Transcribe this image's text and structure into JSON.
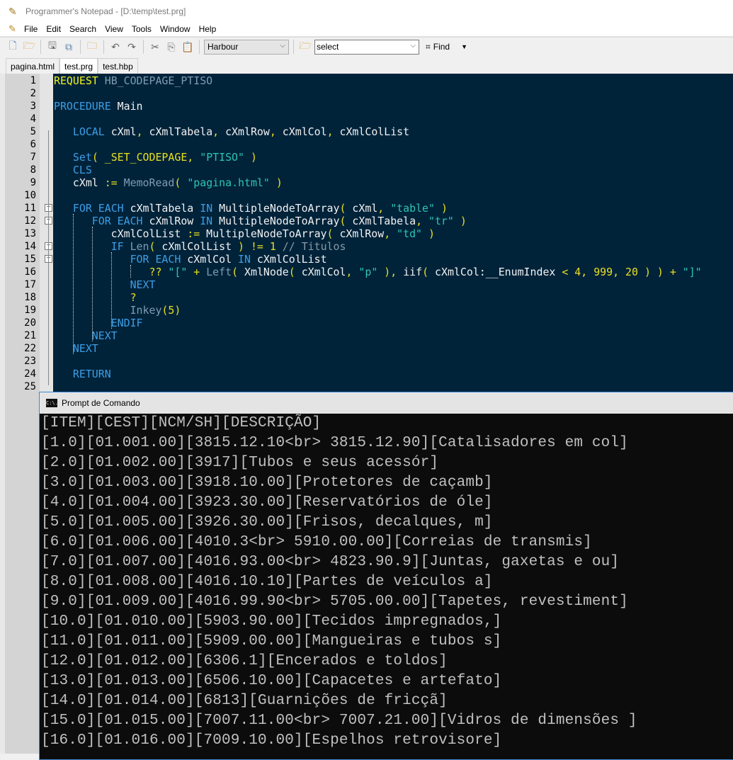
{
  "window": {
    "title": "Programmer's Notepad - [D:\\temp\\test.prg]"
  },
  "menu": [
    "File",
    "Edit",
    "Search",
    "View",
    "Tools",
    "Window",
    "Help"
  ],
  "toolbar": {
    "scheme": "Harbour",
    "find_input": "select",
    "find_label": "Find"
  },
  "tabs": [
    {
      "label": "pagina.html",
      "active": false
    },
    {
      "label": "test.prg",
      "active": true
    },
    {
      "label": "test.hbp",
      "active": false
    }
  ],
  "editor": {
    "lines": [
      [
        [
          "pp",
          "REQUEST"
        ],
        [
          "id",
          " "
        ],
        [
          "cst",
          "HB_CODEPAGE_PTISO"
        ]
      ],
      [],
      [
        [
          "kw",
          "PROCEDURE"
        ],
        [
          "id",
          " Main"
        ]
      ],
      [],
      [
        [
          "id",
          "   "
        ],
        [
          "kw",
          "LOCAL"
        ],
        [
          "id",
          " cXml"
        ],
        [
          "op",
          ","
        ],
        [
          "id",
          " cXmlTabela"
        ],
        [
          "op",
          ","
        ],
        [
          "id",
          " cXmlRow"
        ],
        [
          "op",
          ","
        ],
        [
          "id",
          " cXmlCol"
        ],
        [
          "op",
          ","
        ],
        [
          "id",
          " cXmlColList"
        ]
      ],
      [],
      [
        [
          "id",
          "   "
        ],
        [
          "kw",
          "Set"
        ],
        [
          "op",
          "("
        ],
        [
          "id",
          " "
        ],
        [
          "op",
          "_SET_CODEPAGE"
        ],
        [
          "op",
          ","
        ],
        [
          "id",
          " "
        ],
        [
          "str",
          "\"PTISO\""
        ],
        [
          "id",
          " "
        ],
        [
          "op",
          ")"
        ]
      ],
      [
        [
          "id",
          "   "
        ],
        [
          "kw",
          "CLS"
        ]
      ],
      [
        [
          "id",
          "   cXml "
        ],
        [
          "op",
          ":="
        ],
        [
          "id",
          " "
        ],
        [
          "fn",
          "MemoRead"
        ],
        [
          "op",
          "("
        ],
        [
          "id",
          " "
        ],
        [
          "str",
          "\"pagina.html\""
        ],
        [
          "id",
          " "
        ],
        [
          "op",
          ")"
        ]
      ],
      [],
      [
        [
          "id",
          "   "
        ],
        [
          "kw",
          "FOR EACH"
        ],
        [
          "id",
          " cXmlTabela "
        ],
        [
          "kw",
          "IN"
        ],
        [
          "id",
          " MultipleNodeToArray"
        ],
        [
          "op",
          "("
        ],
        [
          "id",
          " cXml"
        ],
        [
          "op",
          ","
        ],
        [
          "id",
          " "
        ],
        [
          "str",
          "\"table\""
        ],
        [
          "id",
          " "
        ],
        [
          "op",
          ")"
        ]
      ],
      [
        [
          "id",
          "      "
        ],
        [
          "kw",
          "FOR EACH"
        ],
        [
          "id",
          " cXmlRow "
        ],
        [
          "kw",
          "IN"
        ],
        [
          "id",
          " MultipleNodeToArray"
        ],
        [
          "op",
          "("
        ],
        [
          "id",
          " cXmlTabela"
        ],
        [
          "op",
          ","
        ],
        [
          "id",
          " "
        ],
        [
          "str",
          "\"tr\""
        ],
        [
          "id",
          " "
        ],
        [
          "op",
          ")"
        ]
      ],
      [
        [
          "id",
          "         cXmlColList "
        ],
        [
          "op",
          ":="
        ],
        [
          "id",
          " MultipleNodeToArray"
        ],
        [
          "op",
          "("
        ],
        [
          "id",
          " cXmlRow"
        ],
        [
          "op",
          ","
        ],
        [
          "id",
          " "
        ],
        [
          "str",
          "\"td\""
        ],
        [
          "id",
          " "
        ],
        [
          "op",
          ")"
        ]
      ],
      [
        [
          "id",
          "         "
        ],
        [
          "kw",
          "IF"
        ],
        [
          "id",
          " "
        ],
        [
          "fn",
          "Len"
        ],
        [
          "op",
          "("
        ],
        [
          "id",
          " cXmlColList "
        ],
        [
          "op",
          ")"
        ],
        [
          "id",
          " "
        ],
        [
          "op",
          "!="
        ],
        [
          "id",
          " "
        ],
        [
          "num",
          "1"
        ],
        [
          "id",
          " "
        ],
        [
          "cmt",
          "// Titulos"
        ]
      ],
      [
        [
          "id",
          "            "
        ],
        [
          "kw",
          "FOR EACH"
        ],
        [
          "id",
          " cXmlCol "
        ],
        [
          "kw",
          "IN"
        ],
        [
          "id",
          " cXmlColList"
        ]
      ],
      [
        [
          "id",
          "               "
        ],
        [
          "op",
          "??"
        ],
        [
          "id",
          " "
        ],
        [
          "str",
          "\"[\""
        ],
        [
          "id",
          " "
        ],
        [
          "op",
          "+"
        ],
        [
          "id",
          " "
        ],
        [
          "fn",
          "Left"
        ],
        [
          "op",
          "("
        ],
        [
          "id",
          " XmlNode"
        ],
        [
          "op",
          "("
        ],
        [
          "id",
          " cXmlCol"
        ],
        [
          "op",
          ","
        ],
        [
          "id",
          " "
        ],
        [
          "str",
          "\"p\""
        ],
        [
          "id",
          " "
        ],
        [
          "op",
          ")"
        ],
        [
          "op",
          ","
        ],
        [
          "id",
          " iif"
        ],
        [
          "op",
          "("
        ],
        [
          "id",
          " cXmlCol:__EnumIndex "
        ],
        [
          "op",
          "<"
        ],
        [
          "id",
          " "
        ],
        [
          "num",
          "4"
        ],
        [
          "op",
          ","
        ],
        [
          "id",
          " "
        ],
        [
          "num",
          "999"
        ],
        [
          "op",
          ","
        ],
        [
          "id",
          " "
        ],
        [
          "num",
          "20"
        ],
        [
          "id",
          " "
        ],
        [
          "op",
          ")"
        ],
        [
          "id",
          " "
        ],
        [
          "op",
          ")"
        ],
        [
          "id",
          " "
        ],
        [
          "op",
          "+"
        ],
        [
          "id",
          " "
        ],
        [
          "str",
          "\"]\""
        ]
      ],
      [
        [
          "id",
          "            "
        ],
        [
          "kw",
          "NEXT"
        ]
      ],
      [
        [
          "id",
          "            "
        ],
        [
          "op",
          "?"
        ]
      ],
      [
        [
          "id",
          "            "
        ],
        [
          "fn",
          "Inkey"
        ],
        [
          "op",
          "("
        ],
        [
          "num",
          "5"
        ],
        [
          "op",
          ")"
        ]
      ],
      [
        [
          "id",
          "         "
        ],
        [
          "kw",
          "ENDIF"
        ]
      ],
      [
        [
          "id",
          "      "
        ],
        [
          "kw",
          "NEXT"
        ]
      ],
      [
        [
          "id",
          "   "
        ],
        [
          "kw",
          "NEXT"
        ]
      ],
      [],
      [
        [
          "id",
          "   "
        ],
        [
          "kw",
          "RETURN"
        ]
      ],
      []
    ]
  },
  "console": {
    "title": "Prompt de Comando",
    "icon_text": "C:\\.",
    "lines": [
      "[ITEM][CEST][NCM/SH][DESCRIÇÃO]",
      "[1.0][01.001.00][3815.12.10<br> 3815.12.90][Catalisadores em col]",
      "[2.0][01.002.00][3917][Tubos e seus acessór]",
      "[3.0][01.003.00][3918.10.00][Protetores de caçamb]",
      "[4.0][01.004.00][3923.30.00][Reservatórios de óle]",
      "[5.0][01.005.00][3926.30.00][Frisos, decalques, m]",
      "[6.0][01.006.00][4010.3<br> 5910.00.00][Correias de transmis]",
      "[7.0][01.007.00][4016.93.00<br> 4823.90.9][Juntas, gaxetas e ou]",
      "[8.0][01.008.00][4016.10.10][Partes de veículos a]",
      "[9.0][01.009.00][4016.99.90<br> 5705.00.00][Tapetes, revestiment]",
      "[10.0][01.010.00][5903.90.00][Tecidos impregnados,]",
      "[11.0][01.011.00][5909.00.00][Mangueiras e tubos s]",
      "[12.0][01.012.00][6306.1][Encerados e toldos]",
      "[13.0][01.013.00][6506.10.00][Capacetes e artefato]",
      "[14.0][01.014.00][6813][Guarnições de fricçã]",
      "[15.0][01.015.00][7007.11.00<br> 7007.21.00][Vidros de dimensões ]",
      "[16.0][01.016.00][7009.10.00][Espelhos retrovisore]"
    ]
  }
}
